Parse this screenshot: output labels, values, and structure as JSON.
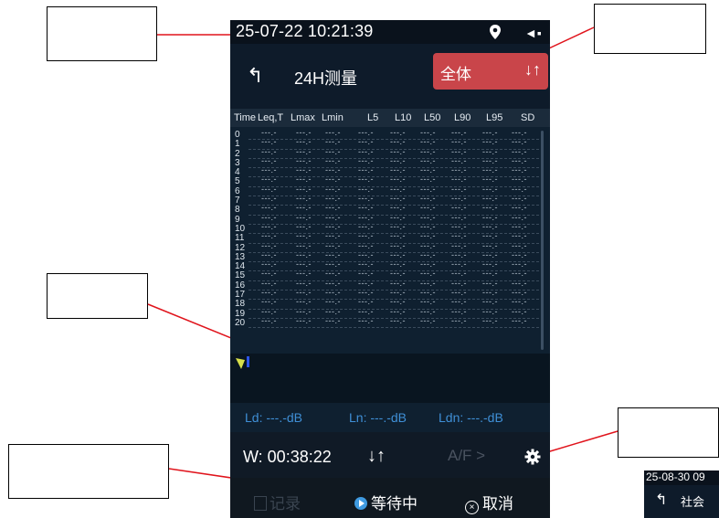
{
  "status_bar": {
    "time": "25-07-22 10:21:39",
    "battery_glyph": "◄▪"
  },
  "header": {
    "back_glyph": "↰",
    "title": "24H测量",
    "mode_label": "全体",
    "mode_sort_glyph": "↓↑"
  },
  "table": {
    "headers": [
      "Time",
      "Leq,T",
      "Lmax",
      "Lmin",
      "L5",
      "L10",
      "L50",
      "L90",
      "L95",
      "SD"
    ],
    "row_indices": [
      "0",
      "1",
      "2",
      "3",
      "4",
      "5",
      "6",
      "7",
      "8",
      "9",
      "10",
      "11",
      "12",
      "13",
      "14",
      "15",
      "16",
      "17",
      "18",
      "19",
      "20"
    ],
    "placeholder": "---.-"
  },
  "summary": {
    "ld": "Ld:  ---.-dB",
    "ln": "Ln:  ---.-dB",
    "ldn": "Ldn:  ---.-dB"
  },
  "controls": {
    "timer": "W: 00:38:22",
    "sort_glyph": "↓↑",
    "af_label": "A/F >"
  },
  "actions": {
    "record": "记录",
    "waiting": "等待中",
    "cancel": "取消"
  },
  "peek": {
    "time": "25-08-30 09",
    "title": "社会"
  },
  "colors": {
    "accent_red": "#c9454a",
    "summary_blue": "#3f8fd6",
    "bg_dark": "#0e1b2a"
  }
}
